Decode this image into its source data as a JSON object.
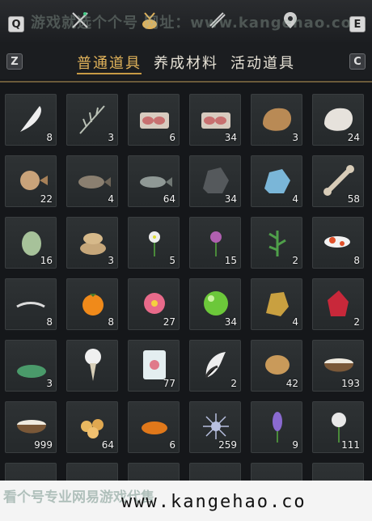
{
  "topbar": {
    "key_left": "Q",
    "key_right": "E",
    "icons": [
      "crossed-swords-icon",
      "money-pouch-icon",
      "scroll-icon",
      "location-pin-icon"
    ],
    "watermark": "游戏就选个个号 网址：www.kangehao.co"
  },
  "tabbar": {
    "key_left": "Z",
    "key_right": "C",
    "tabs": [
      {
        "label": "普通道具",
        "active": true
      },
      {
        "label": "养成材料",
        "active": false
      },
      {
        "label": "活动道具",
        "active": false
      }
    ]
  },
  "inventory": {
    "items": [
      {
        "icon": "white-feather-icon",
        "count": "8"
      },
      {
        "icon": "grass-sprig-icon",
        "count": "3"
      },
      {
        "icon": "raw-meat-icon",
        "count": "6"
      },
      {
        "icon": "raw-meat-icon",
        "count": "34"
      },
      {
        "icon": "brown-fur-pelt-icon",
        "count": "3"
      },
      {
        "icon": "white-fur-pelt-icon",
        "count": "24"
      },
      {
        "icon": "pufferfish-icon",
        "count": "22"
      },
      {
        "icon": "rockfish-icon",
        "count": "4"
      },
      {
        "icon": "grey-fish-icon",
        "count": "64"
      },
      {
        "icon": "dark-ore-icon",
        "count": "34"
      },
      {
        "icon": "blue-crystal-ore-icon",
        "count": "4"
      },
      {
        "icon": "bone-icon",
        "count": "58"
      },
      {
        "icon": "winter-melon-icon",
        "count": "16"
      },
      {
        "icon": "rice-sacks-icon",
        "count": "3"
      },
      {
        "icon": "white-flower-herb-icon",
        "count": "5"
      },
      {
        "icon": "purple-flower-herb-icon",
        "count": "15"
      },
      {
        "icon": "green-herb-icon",
        "count": "2"
      },
      {
        "icon": "koi-fish-icon",
        "count": "8"
      },
      {
        "icon": "shrimp-icon",
        "count": "8"
      },
      {
        "icon": "persimmon-icon",
        "count": "8"
      },
      {
        "icon": "pink-flower-icon",
        "count": "27"
      },
      {
        "icon": "green-orb-icon",
        "count": "34"
      },
      {
        "icon": "gold-ore-icon",
        "count": "4"
      },
      {
        "icon": "red-gem-icon",
        "count": "2"
      },
      {
        "icon": "green-ore-pile-icon",
        "count": "3"
      },
      {
        "icon": "white-bouquet-icon",
        "count": ""
      },
      {
        "icon": "ice-block-icon",
        "count": "77"
      },
      {
        "icon": "fox-tail-icon",
        "count": "2"
      },
      {
        "icon": "walnut-icon",
        "count": "42"
      },
      {
        "icon": "milk-bowl-icon",
        "count": "193"
      },
      {
        "icon": "milk-bowl-icon",
        "count": "999"
      },
      {
        "icon": "pastry-pile-icon",
        "count": "64"
      },
      {
        "icon": "orange-cake-icon",
        "count": "6"
      },
      {
        "icon": "sea-urchin-icon",
        "count": "259"
      },
      {
        "icon": "lavender-icon",
        "count": "9"
      },
      {
        "icon": "dandelion-icon",
        "count": "111"
      }
    ]
  },
  "bottom": {
    "watermark": "看个号专业网易游戏代售",
    "url": "www.kangehao.co"
  },
  "colors": {
    "active_tab": "#e0b25a",
    "inactive_tab": "#e7e2d6",
    "divider": "#6b5a3a",
    "cell_bg": "#2b2f31"
  }
}
